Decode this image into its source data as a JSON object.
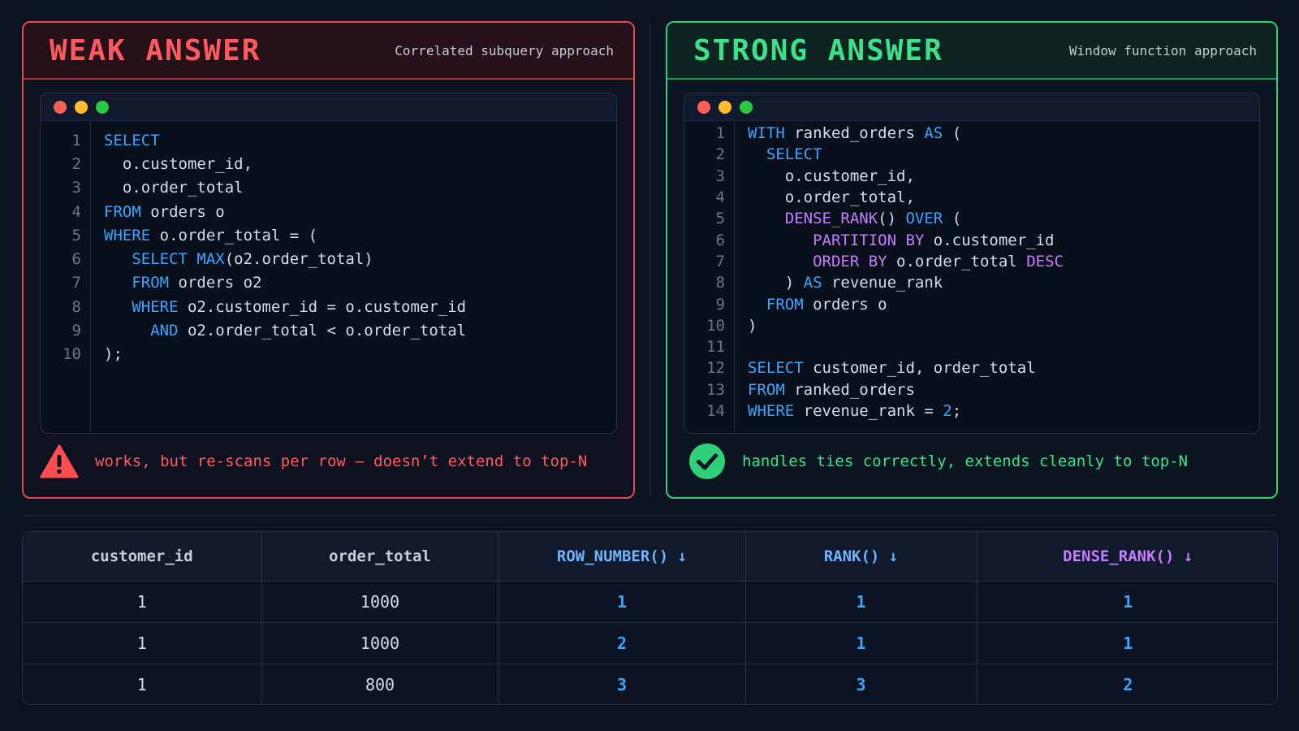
{
  "weak": {
    "title": "WEAK ANSWER",
    "subtitle": "Correlated subquery approach",
    "footer": "works, but re-scans per row — doesn’t extend to top-N",
    "code": [
      {
        "n": "1",
        "parts": [
          {
            "t": "SELECT",
            "c": "kw"
          }
        ]
      },
      {
        "n": "2",
        "parts": [
          {
            "t": "  o.customer_id,",
            "c": ""
          }
        ]
      },
      {
        "n": "3",
        "parts": [
          {
            "t": "  o.order_total",
            "c": ""
          }
        ]
      },
      {
        "n": "4",
        "parts": [
          {
            "t": "FROM",
            "c": "kw"
          },
          {
            "t": " orders o",
            "c": ""
          }
        ]
      },
      {
        "n": "5",
        "parts": [
          {
            "t": "WHERE",
            "c": "kw"
          },
          {
            "t": " o.order_total = (",
            "c": ""
          }
        ]
      },
      {
        "n": "6",
        "parts": [
          {
            "t": "   SELECT ",
            "c": "kw"
          },
          {
            "t": "MAX",
            "c": "kw"
          },
          {
            "t": "(o2.order_total)",
            "c": ""
          }
        ]
      },
      {
        "n": "7",
        "parts": [
          {
            "t": "   FROM",
            "c": "kw"
          },
          {
            "t": " orders o2",
            "c": ""
          }
        ]
      },
      {
        "n": "8",
        "parts": [
          {
            "t": "   WHERE",
            "c": "kw"
          },
          {
            "t": " o2.customer_id = o.customer_id",
            "c": ""
          }
        ]
      },
      {
        "n": "9",
        "parts": [
          {
            "t": "     AND",
            "c": "kw"
          },
          {
            "t": " o2.order_total < o.order_total",
            "c": ""
          }
        ]
      },
      {
        "n": "10",
        "parts": [
          {
            "t": ");",
            "c": ""
          }
        ]
      }
    ]
  },
  "strong": {
    "title": "STRONG ANSWER",
    "subtitle": "Window function approach",
    "footer": "handles ties correctly, extends cleanly to top-N",
    "code": [
      {
        "n": "1",
        "parts": [
          {
            "t": "WITH",
            "c": "kw"
          },
          {
            "t": " ranked_orders ",
            "c": ""
          },
          {
            "t": "AS",
            "c": "kw"
          },
          {
            "t": " (",
            "c": ""
          }
        ]
      },
      {
        "n": "2",
        "parts": [
          {
            "t": "  SELECT",
            "c": "kw"
          }
        ]
      },
      {
        "n": "3",
        "parts": [
          {
            "t": "    o.customer_id,",
            "c": ""
          }
        ]
      },
      {
        "n": "4",
        "parts": [
          {
            "t": "    o.order_total,",
            "c": ""
          }
        ]
      },
      {
        "n": "5",
        "parts": [
          {
            "t": "    DENSE_RANK",
            "c": "pk"
          },
          {
            "t": "() ",
            "c": ""
          },
          {
            "t": "OVER",
            "c": "kw"
          },
          {
            "t": " (",
            "c": ""
          }
        ]
      },
      {
        "n": "6",
        "parts": [
          {
            "t": "       PARTITION BY",
            "c": "pk"
          },
          {
            "t": " o.customer_id",
            "c": ""
          }
        ]
      },
      {
        "n": "7",
        "parts": [
          {
            "t": "       ORDER BY",
            "c": "pk"
          },
          {
            "t": " o.order_total ",
            "c": ""
          },
          {
            "t": "DESC",
            "c": "pk"
          }
        ]
      },
      {
        "n": "8",
        "parts": [
          {
            "t": "    ) ",
            "c": ""
          },
          {
            "t": "AS",
            "c": "kw"
          },
          {
            "t": " revenue_rank",
            "c": ""
          }
        ]
      },
      {
        "n": "9",
        "parts": [
          {
            "t": "  FROM",
            "c": "kw"
          },
          {
            "t": " orders o",
            "c": ""
          }
        ]
      },
      {
        "n": "10",
        "parts": [
          {
            "t": ")",
            "c": ""
          }
        ]
      },
      {
        "n": "11",
        "parts": []
      },
      {
        "n": "12",
        "parts": [
          {
            "t": "SELECT",
            "c": "kw"
          },
          {
            "t": " customer_id, order_total",
            "c": ""
          }
        ]
      },
      {
        "n": "13",
        "parts": [
          {
            "t": "FROM",
            "c": "kw"
          },
          {
            "t": " ranked_orders",
            "c": ""
          }
        ]
      },
      {
        "n": "14",
        "parts": [
          {
            "t": "WHERE",
            "c": "kw"
          },
          {
            "t": " revenue_rank = ",
            "c": ""
          },
          {
            "t": "2",
            "c": "num"
          },
          {
            "t": ";",
            "c": ""
          }
        ]
      }
    ]
  },
  "table": {
    "headers": [
      "customer_id",
      "order_total",
      "ROW_NUMBER() ↓",
      "RANK() ↓",
      "DENSE_RANK() ↓"
    ],
    "rows": [
      [
        "1",
        "1000",
        "1",
        "1",
        "1"
      ],
      [
        "1",
        "1000",
        "2",
        "1",
        "1"
      ],
      [
        "1",
        "800",
        "3",
        "3",
        "2"
      ]
    ]
  },
  "colors": {
    "weak_accent": "#ff5a5f",
    "strong_accent": "#3ee08a",
    "keyword": "#3ba6ff",
    "window_keyword": "#c77dff"
  },
  "icons": {
    "weak_footer": "warning-triangle-icon",
    "strong_footer": "check-circle-icon"
  }
}
